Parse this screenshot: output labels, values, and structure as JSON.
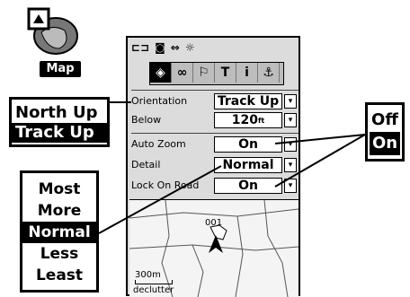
{
  "app_icon": {
    "label": "Map"
  },
  "status_icons": [
    "battery-plug-icon",
    "satellite-signal-icon",
    "sync-arrows-icon",
    "sun-backlight-icon"
  ],
  "tabs": [
    {
      "name": "map-setup-tab",
      "glyph": "◈"
    },
    {
      "name": "tracks-tab",
      "glyph": "∞"
    },
    {
      "name": "waypoint-flag-tab",
      "glyph": "⚐"
    },
    {
      "name": "text-tab",
      "glyph": "T"
    },
    {
      "name": "info-tab",
      "glyph": "i"
    },
    {
      "name": "anchor-tab",
      "glyph": "⚓"
    }
  ],
  "settings": {
    "orientation": {
      "label": "Orientation",
      "value": "Track Up"
    },
    "below": {
      "label": "Below",
      "value": "120",
      "unit": "ft"
    },
    "auto_zoom": {
      "label": "Auto Zoom",
      "value": "On"
    },
    "detail": {
      "label": "Detail",
      "value": "Normal"
    },
    "lock_on_road": {
      "label": "Lock On Road",
      "value": "On"
    }
  },
  "map": {
    "waypoint": "001",
    "scale_value": "300",
    "scale_unit": "m",
    "declutter": "declutter"
  },
  "orientation_popup": {
    "options": [
      "North Up",
      "Track Up"
    ],
    "selected": "Track Up"
  },
  "detail_popup": {
    "options": [
      "Most",
      "More",
      "Normal",
      "Less",
      "Least"
    ],
    "selected": "Normal"
  },
  "onoff_popup": {
    "options": [
      "Off",
      "On"
    ],
    "selected": "On"
  }
}
